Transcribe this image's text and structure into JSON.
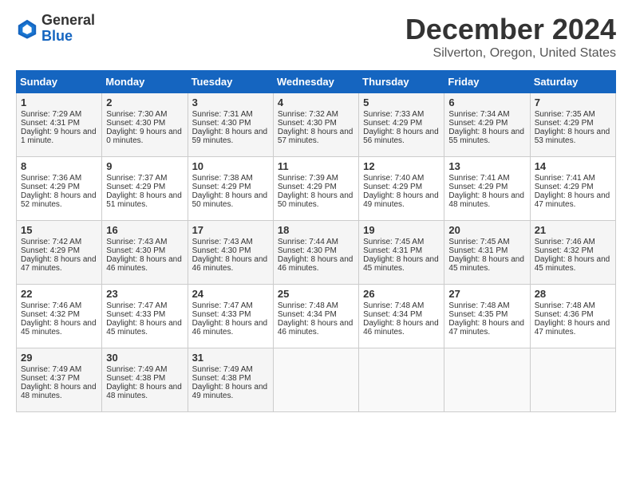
{
  "header": {
    "logo_line1": "General",
    "logo_line2": "Blue",
    "main_title": "December 2024",
    "subtitle": "Silverton, Oregon, United States"
  },
  "calendar": {
    "days_of_week": [
      "Sunday",
      "Monday",
      "Tuesday",
      "Wednesday",
      "Thursday",
      "Friday",
      "Saturday"
    ],
    "weeks": [
      [
        {
          "day": "1",
          "sunrise": "Sunrise: 7:29 AM",
          "sunset": "Sunset: 4:31 PM",
          "daylight": "Daylight: 9 hours and 1 minute."
        },
        {
          "day": "2",
          "sunrise": "Sunrise: 7:30 AM",
          "sunset": "Sunset: 4:30 PM",
          "daylight": "Daylight: 9 hours and 0 minutes."
        },
        {
          "day": "3",
          "sunrise": "Sunrise: 7:31 AM",
          "sunset": "Sunset: 4:30 PM",
          "daylight": "Daylight: 8 hours and 59 minutes."
        },
        {
          "day": "4",
          "sunrise": "Sunrise: 7:32 AM",
          "sunset": "Sunset: 4:30 PM",
          "daylight": "Daylight: 8 hours and 57 minutes."
        },
        {
          "day": "5",
          "sunrise": "Sunrise: 7:33 AM",
          "sunset": "Sunset: 4:29 PM",
          "daylight": "Daylight: 8 hours and 56 minutes."
        },
        {
          "day": "6",
          "sunrise": "Sunrise: 7:34 AM",
          "sunset": "Sunset: 4:29 PM",
          "daylight": "Daylight: 8 hours and 55 minutes."
        },
        {
          "day": "7",
          "sunrise": "Sunrise: 7:35 AM",
          "sunset": "Sunset: 4:29 PM",
          "daylight": "Daylight: 8 hours and 53 minutes."
        }
      ],
      [
        {
          "day": "8",
          "sunrise": "Sunrise: 7:36 AM",
          "sunset": "Sunset: 4:29 PM",
          "daylight": "Daylight: 8 hours and 52 minutes."
        },
        {
          "day": "9",
          "sunrise": "Sunrise: 7:37 AM",
          "sunset": "Sunset: 4:29 PM",
          "daylight": "Daylight: 8 hours and 51 minutes."
        },
        {
          "day": "10",
          "sunrise": "Sunrise: 7:38 AM",
          "sunset": "Sunset: 4:29 PM",
          "daylight": "Daylight: 8 hours and 50 minutes."
        },
        {
          "day": "11",
          "sunrise": "Sunrise: 7:39 AM",
          "sunset": "Sunset: 4:29 PM",
          "daylight": "Daylight: 8 hours and 50 minutes."
        },
        {
          "day": "12",
          "sunrise": "Sunrise: 7:40 AM",
          "sunset": "Sunset: 4:29 PM",
          "daylight": "Daylight: 8 hours and 49 minutes."
        },
        {
          "day": "13",
          "sunrise": "Sunrise: 7:41 AM",
          "sunset": "Sunset: 4:29 PM",
          "daylight": "Daylight: 8 hours and 48 minutes."
        },
        {
          "day": "14",
          "sunrise": "Sunrise: 7:41 AM",
          "sunset": "Sunset: 4:29 PM",
          "daylight": "Daylight: 8 hours and 47 minutes."
        }
      ],
      [
        {
          "day": "15",
          "sunrise": "Sunrise: 7:42 AM",
          "sunset": "Sunset: 4:29 PM",
          "daylight": "Daylight: 8 hours and 47 minutes."
        },
        {
          "day": "16",
          "sunrise": "Sunrise: 7:43 AM",
          "sunset": "Sunset: 4:30 PM",
          "daylight": "Daylight: 8 hours and 46 minutes."
        },
        {
          "day": "17",
          "sunrise": "Sunrise: 7:43 AM",
          "sunset": "Sunset: 4:30 PM",
          "daylight": "Daylight: 8 hours and 46 minutes."
        },
        {
          "day": "18",
          "sunrise": "Sunrise: 7:44 AM",
          "sunset": "Sunset: 4:30 PM",
          "daylight": "Daylight: 8 hours and 46 minutes."
        },
        {
          "day": "19",
          "sunrise": "Sunrise: 7:45 AM",
          "sunset": "Sunset: 4:31 PM",
          "daylight": "Daylight: 8 hours and 45 minutes."
        },
        {
          "day": "20",
          "sunrise": "Sunrise: 7:45 AM",
          "sunset": "Sunset: 4:31 PM",
          "daylight": "Daylight: 8 hours and 45 minutes."
        },
        {
          "day": "21",
          "sunrise": "Sunrise: 7:46 AM",
          "sunset": "Sunset: 4:32 PM",
          "daylight": "Daylight: 8 hours and 45 minutes."
        }
      ],
      [
        {
          "day": "22",
          "sunrise": "Sunrise: 7:46 AM",
          "sunset": "Sunset: 4:32 PM",
          "daylight": "Daylight: 8 hours and 45 minutes."
        },
        {
          "day": "23",
          "sunrise": "Sunrise: 7:47 AM",
          "sunset": "Sunset: 4:33 PM",
          "daylight": "Daylight: 8 hours and 45 minutes."
        },
        {
          "day": "24",
          "sunrise": "Sunrise: 7:47 AM",
          "sunset": "Sunset: 4:33 PM",
          "daylight": "Daylight: 8 hours and 46 minutes."
        },
        {
          "day": "25",
          "sunrise": "Sunrise: 7:48 AM",
          "sunset": "Sunset: 4:34 PM",
          "daylight": "Daylight: 8 hours and 46 minutes."
        },
        {
          "day": "26",
          "sunrise": "Sunrise: 7:48 AM",
          "sunset": "Sunset: 4:34 PM",
          "daylight": "Daylight: 8 hours and 46 minutes."
        },
        {
          "day": "27",
          "sunrise": "Sunrise: 7:48 AM",
          "sunset": "Sunset: 4:35 PM",
          "daylight": "Daylight: 8 hours and 47 minutes."
        },
        {
          "day": "28",
          "sunrise": "Sunrise: 7:48 AM",
          "sunset": "Sunset: 4:36 PM",
          "daylight": "Daylight: 8 hours and 47 minutes."
        }
      ],
      [
        {
          "day": "29",
          "sunrise": "Sunrise: 7:49 AM",
          "sunset": "Sunset: 4:37 PM",
          "daylight": "Daylight: 8 hours and 48 minutes."
        },
        {
          "day": "30",
          "sunrise": "Sunrise: 7:49 AM",
          "sunset": "Sunset: 4:38 PM",
          "daylight": "Daylight: 8 hours and 48 minutes."
        },
        {
          "day": "31",
          "sunrise": "Sunrise: 7:49 AM",
          "sunset": "Sunset: 4:38 PM",
          "daylight": "Daylight: 8 hours and 49 minutes."
        },
        null,
        null,
        null,
        null
      ]
    ]
  }
}
